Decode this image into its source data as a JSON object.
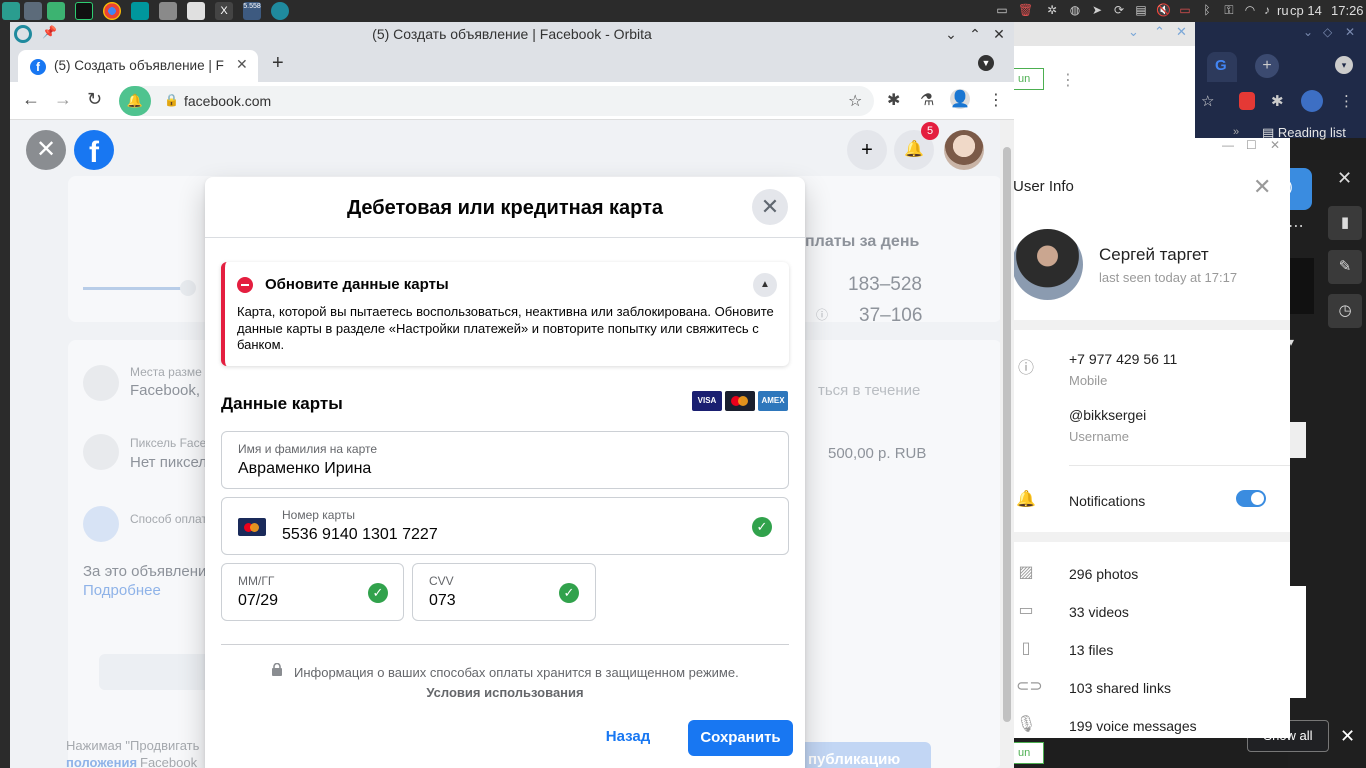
{
  "taskbar": {
    "lang": "ru",
    "date": "ср 14",
    "time": "17:26",
    "badge": "5.558"
  },
  "browser": {
    "window_title": "(5) Создать объявление | Facebook - Orbita",
    "tab_title": "(5) Создать объявление | Fa",
    "url": "facebook.com"
  },
  "facebook": {
    "notif_count": "5",
    "bg": {
      "col_head": "платы за день",
      "range1": "183–528",
      "range2": "37–106",
      "placements_label": "Места разме",
      "placements_value": "Facebook,",
      "pixel_label": "Пиксель Face",
      "pixel_value": "Нет пиксел",
      "payment_label": "Способ оплат",
      "for_ad": "За это объявлени",
      "more": "Подробнее",
      "within": "ться в течение",
      "amount": "500,00 р. RUB",
      "footer1": "Нажимая \"Продвигать",
      "footer2_link": "положения",
      "footer2": "Facebook",
      "publish": "публикацию"
    }
  },
  "dialog": {
    "title": "Дебетовая или кредитная карта",
    "alert": {
      "title": "Обновите данные карты",
      "body": "Карта, которой вы пытаетесь воспользоваться, неактивна или заблокирована. Обновите данные карты в разделе «Настройки платежей» и повторите попытку или свяжитесь с банком."
    },
    "card_section": "Данные карты",
    "card_logos": [
      "VISA",
      "MC",
      "AMEX"
    ],
    "name_label": "Имя и фамилия на карте",
    "name_value": "Авраменко Ирина",
    "number_label": "Номер карты",
    "number_value": "5536 9140 1301 7227",
    "exp_label": "ММ/ГГ",
    "exp_value": "07/29",
    "cvv_label": "CVV",
    "cvv_value": "073",
    "secure_text": "Информация о ваших способах оплаты хранится в защищенном режиме.",
    "terms": "Условия использования",
    "back": "Назад",
    "save": "Сохранить"
  },
  "telegram": {
    "title": "User Info",
    "name": "Сергей таргет",
    "last_seen": "last seen today at 17:17",
    "phone": "+7 977 429 56 11",
    "phone_label": "Mobile",
    "username": "@bikksergei",
    "username_label": "Username",
    "notifications": "Notifications",
    "notifications_on": true,
    "media": {
      "photos": "296 photos",
      "videos": "33 videos",
      "files": "13 files",
      "links": "103 shared links",
      "voice": "199 voice messages"
    }
  },
  "other": {
    "reading_list": "Reading list",
    "show_all": "Show all",
    "run1": "un",
    "run2": "un"
  },
  "colors": {
    "fb_blue": "#1877f2",
    "alert_red": "#e41e3f",
    "check_green": "#31a24c",
    "tg_toggle": "#3a8ce0"
  }
}
